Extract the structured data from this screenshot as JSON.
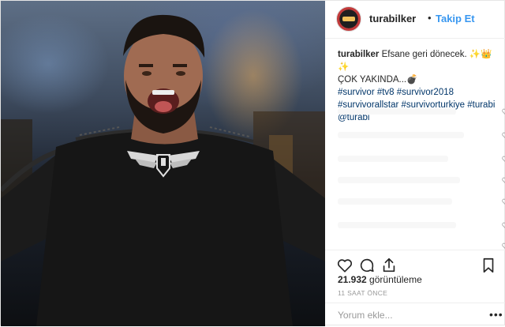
{
  "post": {
    "username": "turabilker",
    "separator": "•",
    "follow_label": "Takip Et",
    "caption": {
      "username": "turabilker",
      "text": "Efsane geri dönecek. ✨👑✨",
      "text2": "ÇOK YAKINDA...💣",
      "hashtags_line1": "#survivor #tv8 #survivor2018",
      "hashtags_line2": "#survivorallstar #survivorturkiye #turabi",
      "mention": "@turabi"
    },
    "views_count": "21.932",
    "views_label": "görüntüleme",
    "timestamp": "11 SAAT ÖNCE",
    "comment_placeholder": "Yorum ekle...",
    "more_label": "•••"
  },
  "icons": [
    "heart-icon",
    "comment-icon",
    "share-icon",
    "bookmark-icon",
    "more-icon"
  ],
  "colors": {
    "link": "#3897f0",
    "text": "#262626",
    "meta": "#999999",
    "tag": "#003569"
  }
}
